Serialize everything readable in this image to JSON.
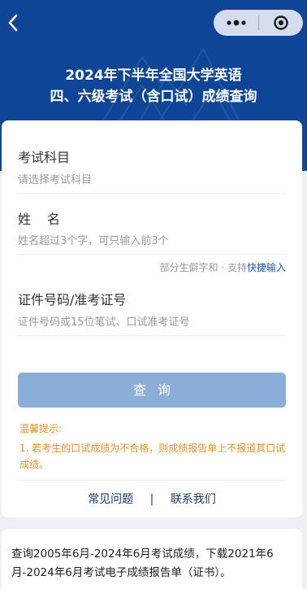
{
  "header": {
    "title_line1": "2024年下半年全国大学英语",
    "title_line2": "四、六级考试（含口试）成绩查询"
  },
  "colors": {
    "hero_bg": "#0e4596",
    "button_bg": "#8aaed8",
    "tip_color": "#e8902b",
    "link_color": "#1e5aaa"
  },
  "icons": {
    "back": "chevron-left-icon",
    "more": "more-dots-icon",
    "close": "target-close-icon"
  },
  "form": {
    "subject": {
      "label": "考试科目",
      "placeholder": "请选择考试科目"
    },
    "name": {
      "label": "姓名",
      "placeholder": "姓名超过3个字，可只输入前3个"
    },
    "hint": {
      "prefix": "部分生僻字和 · 支持",
      "link": "快捷输入"
    },
    "id": {
      "label": "证件号码/准考证号",
      "placeholder": "证件号码或15位笔试、口试准考证号"
    },
    "submit_label": "查询"
  },
  "tips": {
    "title": "温馨提示:",
    "body": "1. 若考生的口试成绩为不合格，则成绩报告单上不报道其口试成绩。"
  },
  "footer_links": {
    "faq": "常见问题",
    "separator": "|",
    "contact": "联系我们"
  },
  "info": {
    "text": "查询2005年6月-2024年6月考试成绩，下载2021年6月-2024年6月考试电子成绩报告单（证书）。"
  }
}
